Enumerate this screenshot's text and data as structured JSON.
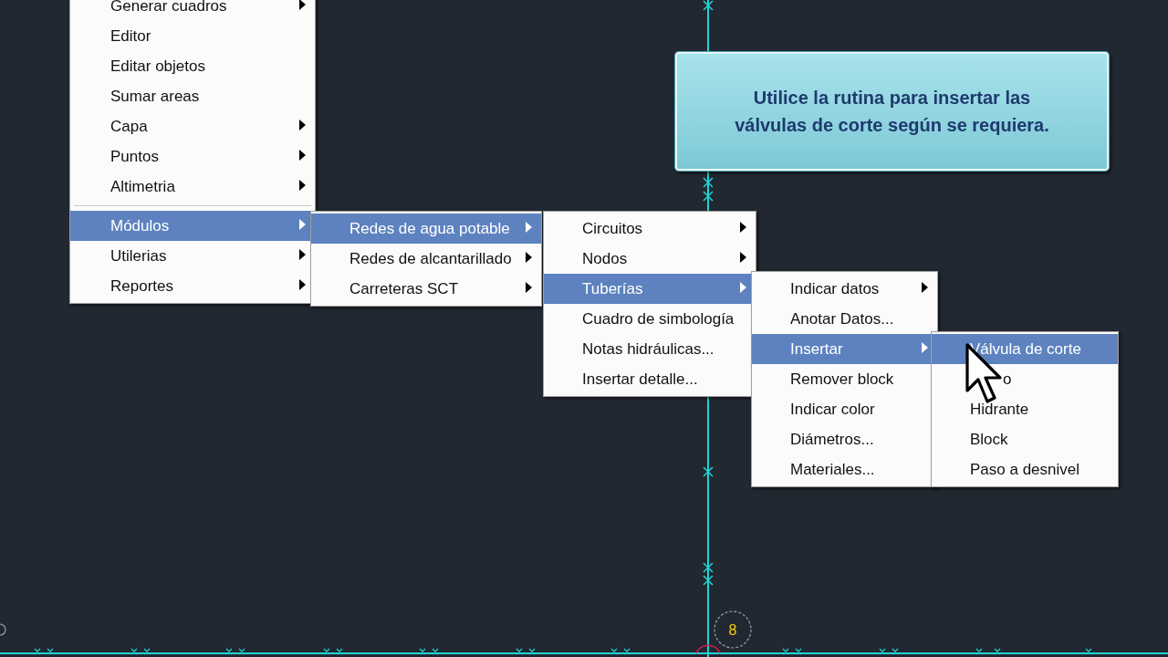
{
  "callout": {
    "text": "Utilice la rutina para insertar las válvulas de corte según se requiera."
  },
  "drawing": {
    "label": "8"
  },
  "menus": [
    {
      "items": [
        {
          "kind": "item",
          "label": "Generar cuadros",
          "submenu": true,
          "selected": false
        },
        {
          "kind": "item",
          "label": "Editor",
          "submenu": false,
          "selected": false
        },
        {
          "kind": "item",
          "label": "Editar objetos",
          "submenu": false,
          "selected": false
        },
        {
          "kind": "item",
          "label": "Sumar areas",
          "submenu": false,
          "selected": false
        },
        {
          "kind": "item",
          "label": "Capa",
          "submenu": true,
          "selected": false
        },
        {
          "kind": "item",
          "label": "Puntos",
          "submenu": true,
          "selected": false
        },
        {
          "kind": "item",
          "label": "Altimetria",
          "submenu": true,
          "selected": false
        },
        {
          "kind": "separator"
        },
        {
          "kind": "item",
          "label": "Módulos",
          "submenu": true,
          "selected": true
        },
        {
          "kind": "item",
          "label": "Utilerias",
          "submenu": true,
          "selected": false
        },
        {
          "kind": "item",
          "label": "Reportes",
          "submenu": true,
          "selected": false
        }
      ]
    },
    {
      "items": [
        {
          "kind": "item",
          "label": "Redes de agua potable",
          "submenu": true,
          "selected": true
        },
        {
          "kind": "item",
          "label": "Redes de alcantarillado",
          "submenu": true,
          "selected": false
        },
        {
          "kind": "item",
          "label": "Carreteras SCT",
          "submenu": true,
          "selected": false
        }
      ]
    },
    {
      "items": [
        {
          "kind": "item",
          "label": "Circuitos",
          "submenu": true,
          "selected": false
        },
        {
          "kind": "item",
          "label": "Nodos",
          "submenu": true,
          "selected": false
        },
        {
          "kind": "item",
          "label": "Tuberías",
          "submenu": true,
          "selected": true
        },
        {
          "kind": "item",
          "label": "Cuadro de simbología",
          "submenu": false,
          "selected": false
        },
        {
          "kind": "item",
          "label": "Notas hidráulicas...",
          "submenu": false,
          "selected": false
        },
        {
          "kind": "item",
          "label": "Insertar detalle...",
          "submenu": false,
          "selected": false
        }
      ]
    },
    {
      "items": [
        {
          "kind": "item",
          "label": "Indicar datos",
          "submenu": true,
          "selected": false
        },
        {
          "kind": "item",
          "label": "Anotar Datos...",
          "submenu": false,
          "selected": false
        },
        {
          "kind": "item",
          "label": "Insertar",
          "submenu": true,
          "selected": true
        },
        {
          "kind": "item",
          "label": "Remover block",
          "submenu": false,
          "selected": false
        },
        {
          "kind": "item",
          "label": "Indicar color",
          "submenu": false,
          "selected": false
        },
        {
          "kind": "item",
          "label": "Diámetros...",
          "submenu": false,
          "selected": false
        },
        {
          "kind": "item",
          "label": "Materiales...",
          "submenu": false,
          "selected": false
        }
      ]
    },
    {
      "items": [
        {
          "kind": "item",
          "label": "Válvula de corte",
          "submenu": false,
          "selected": true
        },
        {
          "kind": "covered",
          "label": "o",
          "submenu": false,
          "selected": false
        },
        {
          "kind": "item",
          "label": "Hidrante",
          "submenu": false,
          "selected": false
        },
        {
          "kind": "item",
          "label": "Block",
          "submenu": false,
          "selected": false
        },
        {
          "kind": "item",
          "label": "Paso a desnivel",
          "submenu": false,
          "selected": false
        }
      ]
    }
  ]
}
